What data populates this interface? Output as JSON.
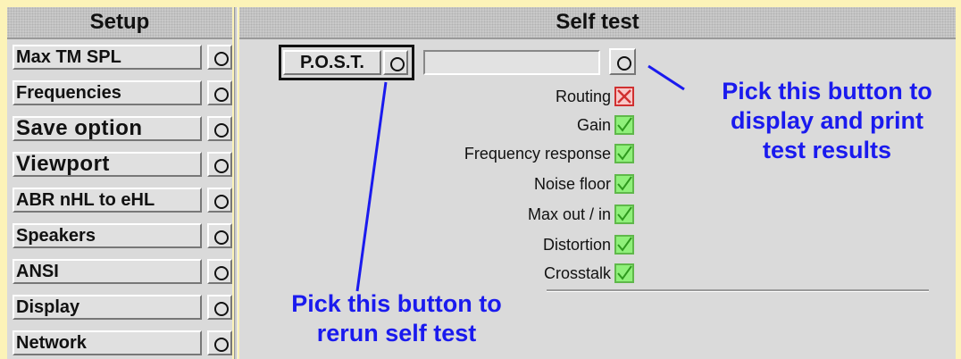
{
  "setup": {
    "title": "Setup",
    "items": [
      {
        "label": "Max TM SPL",
        "big": false
      },
      {
        "label": "Frequencies",
        "big": false
      },
      {
        "label": "Save option",
        "big": true
      },
      {
        "label": "Viewport",
        "big": true
      },
      {
        "label": "ABR nHL to eHL",
        "big": false
      },
      {
        "label": "Speakers",
        "big": false
      },
      {
        "label": "ANSI",
        "big": false
      },
      {
        "label": "Display",
        "big": false
      },
      {
        "label": "Network",
        "big": false
      }
    ]
  },
  "selftest": {
    "title": "Self test",
    "post_label": "P.O.S.T.",
    "tests": [
      {
        "label": "Routing",
        "status": "fail"
      },
      {
        "label": "Gain",
        "status": "pass"
      },
      {
        "label": "Frequency response",
        "status": "pass"
      },
      {
        "label": "Noise floor",
        "status": "pass"
      },
      {
        "label": "Max out / in",
        "status": "pass"
      },
      {
        "label": "Distortion",
        "status": "pass"
      },
      {
        "label": "Crosstalk",
        "status": "pass"
      }
    ]
  },
  "annotations": {
    "results_line1": "Pick this button to",
    "results_line2": "display and print",
    "results_line3": "test results",
    "rerun_line1": "Pick this button to",
    "rerun_line2": "rerun self test"
  },
  "colors": {
    "background": "#fcf3b8",
    "panel": "#dadada",
    "annotation": "#1a1aee",
    "pass": "#8ff07a",
    "fail": "#d03030"
  }
}
